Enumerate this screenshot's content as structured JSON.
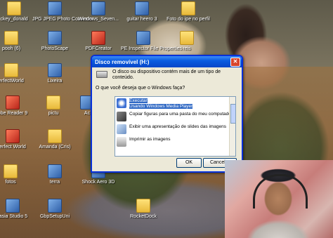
{
  "desktop": {
    "icons": [
      {
        "label": "ckey_donald",
        "kind": "folder"
      },
      {
        "label": "JPG JPEG Photo Converter",
        "kind": "app"
      },
      {
        "label": "Windows_Seven...",
        "kind": "app"
      },
      {
        "label": "guitar heero 3",
        "kind": "app"
      },
      {
        "label": "Foto do ipe no perfil",
        "kind": "folder"
      },
      {
        "label": "pooh (6)",
        "kind": "folder"
      },
      {
        "label": "PhotoScape",
        "kind": "app"
      },
      {
        "label": "PDFCreator",
        "kind": "red"
      },
      {
        "label": "PE Inspector File Properties",
        "kind": "app"
      },
      {
        "label": "reis",
        "kind": "folder"
      },
      {
        "label": "erfectWorld",
        "kind": "folder"
      },
      {
        "label": "Lixeira",
        "kind": "app"
      },
      {
        "label": "obe Reader 9",
        "kind": "red"
      },
      {
        "label": "pictu",
        "kind": "folder"
      },
      {
        "label": "Ac",
        "kind": "app"
      },
      {
        "label": "erfect World",
        "kind": "red"
      },
      {
        "label": "Amanda (Cris)",
        "kind": "folder"
      },
      {
        "label": "fotos",
        "kind": "folder"
      },
      {
        "label": "terra",
        "kind": "app"
      },
      {
        "label": "Shock Aero 3D",
        "kind": "app"
      },
      {
        "label": "tasia Studio 5",
        "kind": "app"
      },
      {
        "label": "GbpSetupUni",
        "kind": "app"
      },
      {
        "label": "RocketDock",
        "kind": "app"
      }
    ]
  },
  "dialog": {
    "title": "Disco removível (H:)",
    "close_glyph": "✕",
    "message": "O disco ou dispositivo contém mais de um tipo de conteúdo.",
    "question": "O que você deseja que o Windows faça?",
    "options": [
      {
        "label": "Executar\nUsando Windows Media Player",
        "selected": true,
        "icon": "media-player-icon"
      },
      {
        "label": "Copiar figuras para uma pasta do meu computador",
        "selected": false,
        "icon": "camera-icon"
      },
      {
        "label": "Exibir uma apresentação de slides das imagens",
        "selected": false,
        "icon": "slideshow-icon"
      },
      {
        "label": "Imprimir as imagens",
        "selected": false,
        "icon": "printer-icon"
      }
    ],
    "ok_label": "OK",
    "cancel_label": "Cancelar"
  },
  "colors": {
    "titlebar": "#0a5ce0",
    "selection": "#316ac5",
    "dialog_bg": "#ece9d8"
  }
}
